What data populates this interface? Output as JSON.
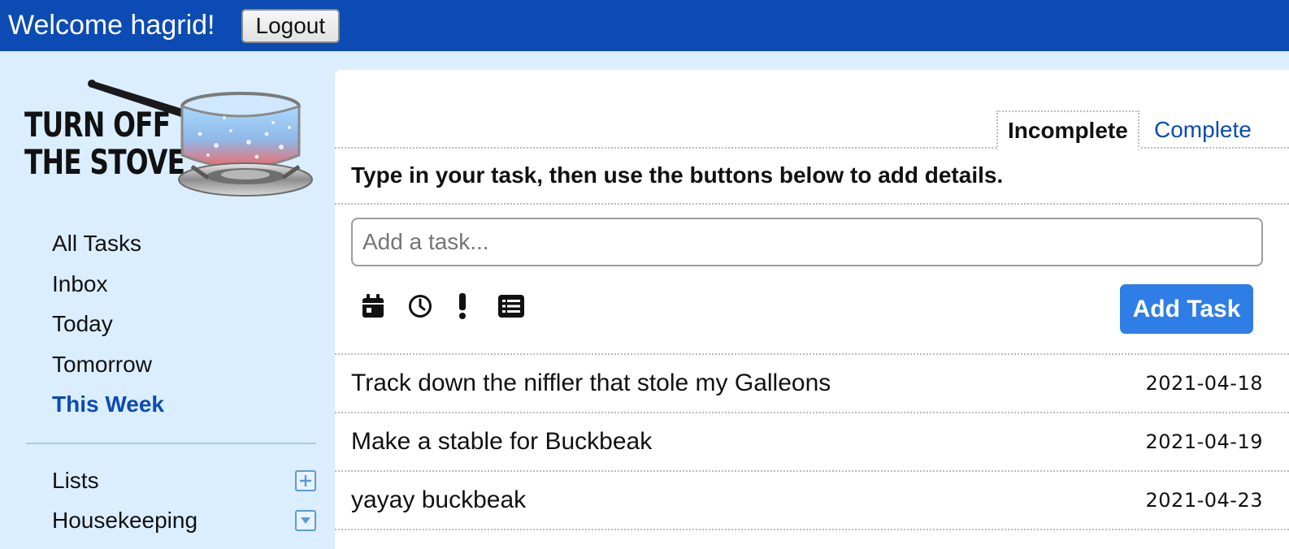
{
  "header": {
    "welcome": "Welcome hagrid!",
    "logout_label": "Logout"
  },
  "logo": {
    "line1": "TURN OFF",
    "line2": "THE STOVE"
  },
  "sidebar": {
    "nav": [
      {
        "label": "All Tasks",
        "active": false
      },
      {
        "label": "Inbox",
        "active": false
      },
      {
        "label": "Today",
        "active": false
      },
      {
        "label": "Tomorrow",
        "active": false
      },
      {
        "label": "This Week",
        "active": true
      }
    ],
    "lists_label": "Lists",
    "lists_icon": "plus-square-icon",
    "lists": [
      {
        "label": "Housekeeping",
        "icon": "caret-down-square-icon"
      }
    ]
  },
  "tabs": {
    "incomplete": "Incomplete",
    "complete": "Complete",
    "active": "incomplete"
  },
  "instruction": "Type in your task, then use the buttons below to add details.",
  "task_input": {
    "placeholder": "Add a task...",
    "value": ""
  },
  "tools": [
    "calendar-icon",
    "clock-icon",
    "priority-icon",
    "list-icon"
  ],
  "add_task_label": "Add Task",
  "tasks": [
    {
      "title": "Track down the niffler that stole my Galleons",
      "date": "2021-04-18"
    },
    {
      "title": "Make a stable for Buckbeak",
      "date": "2021-04-19"
    },
    {
      "title": "yayay buckbeak",
      "date": "2021-04-23"
    }
  ],
  "colors": {
    "header": "#0b4bb3",
    "sidebar": "#dbeeff",
    "accent": "#2f7ee6",
    "active_link": "#0b4bb3"
  }
}
